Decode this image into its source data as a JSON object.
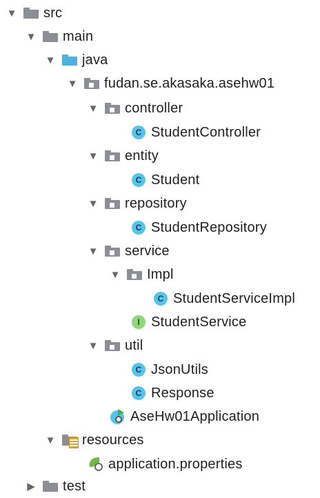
{
  "tree": {
    "src": {
      "label": "src",
      "arrow": "▼"
    },
    "main": {
      "label": "main",
      "arrow": "▼"
    },
    "java": {
      "label": "java",
      "arrow": "▼"
    },
    "package": {
      "label": "fudan.se.akasaka.asehw01",
      "arrow": "▼"
    },
    "controller": {
      "label": "controller",
      "arrow": "▼"
    },
    "student_controller": {
      "label": "StudentController",
      "badge": "C"
    },
    "entity": {
      "label": "entity",
      "arrow": "▼"
    },
    "student": {
      "label": "Student",
      "badge": "C"
    },
    "repository": {
      "label": "repository",
      "arrow": "▼"
    },
    "student_repository": {
      "label": "StudentRepository",
      "badge": "C"
    },
    "service": {
      "label": "service",
      "arrow": "▼"
    },
    "impl": {
      "label": "Impl",
      "arrow": "▼"
    },
    "student_service_impl": {
      "label": "StudentServiceImpl",
      "badge": "C"
    },
    "student_service": {
      "label": "StudentService",
      "badge": "I"
    },
    "util": {
      "label": "util",
      "arrow": "▼"
    },
    "json_utils": {
      "label": "JsonUtils",
      "badge": "C"
    },
    "response": {
      "label": "Response",
      "badge": "C"
    },
    "app": {
      "label": "AseHw01Application"
    },
    "resources": {
      "label": "resources",
      "arrow": "▼"
    },
    "app_properties": {
      "label": "application.properties"
    },
    "test": {
      "label": "test",
      "arrow": "▶"
    }
  },
  "colors": {
    "folder_gray": "#8b8f95",
    "folder_source": "#4fb1df",
    "class_badge": "#56c3ea",
    "interface_badge": "#8fd67d",
    "spring_green": "#44b04f"
  },
  "icons": {
    "folder": "folder-icon",
    "source_folder": "source-folder-icon",
    "package": "package-icon",
    "class": "class-icon",
    "interface": "interface-icon",
    "spring_app": "spring-boot-app-icon",
    "resources": "resources-folder-icon",
    "properties": "properties-file-icon"
  }
}
